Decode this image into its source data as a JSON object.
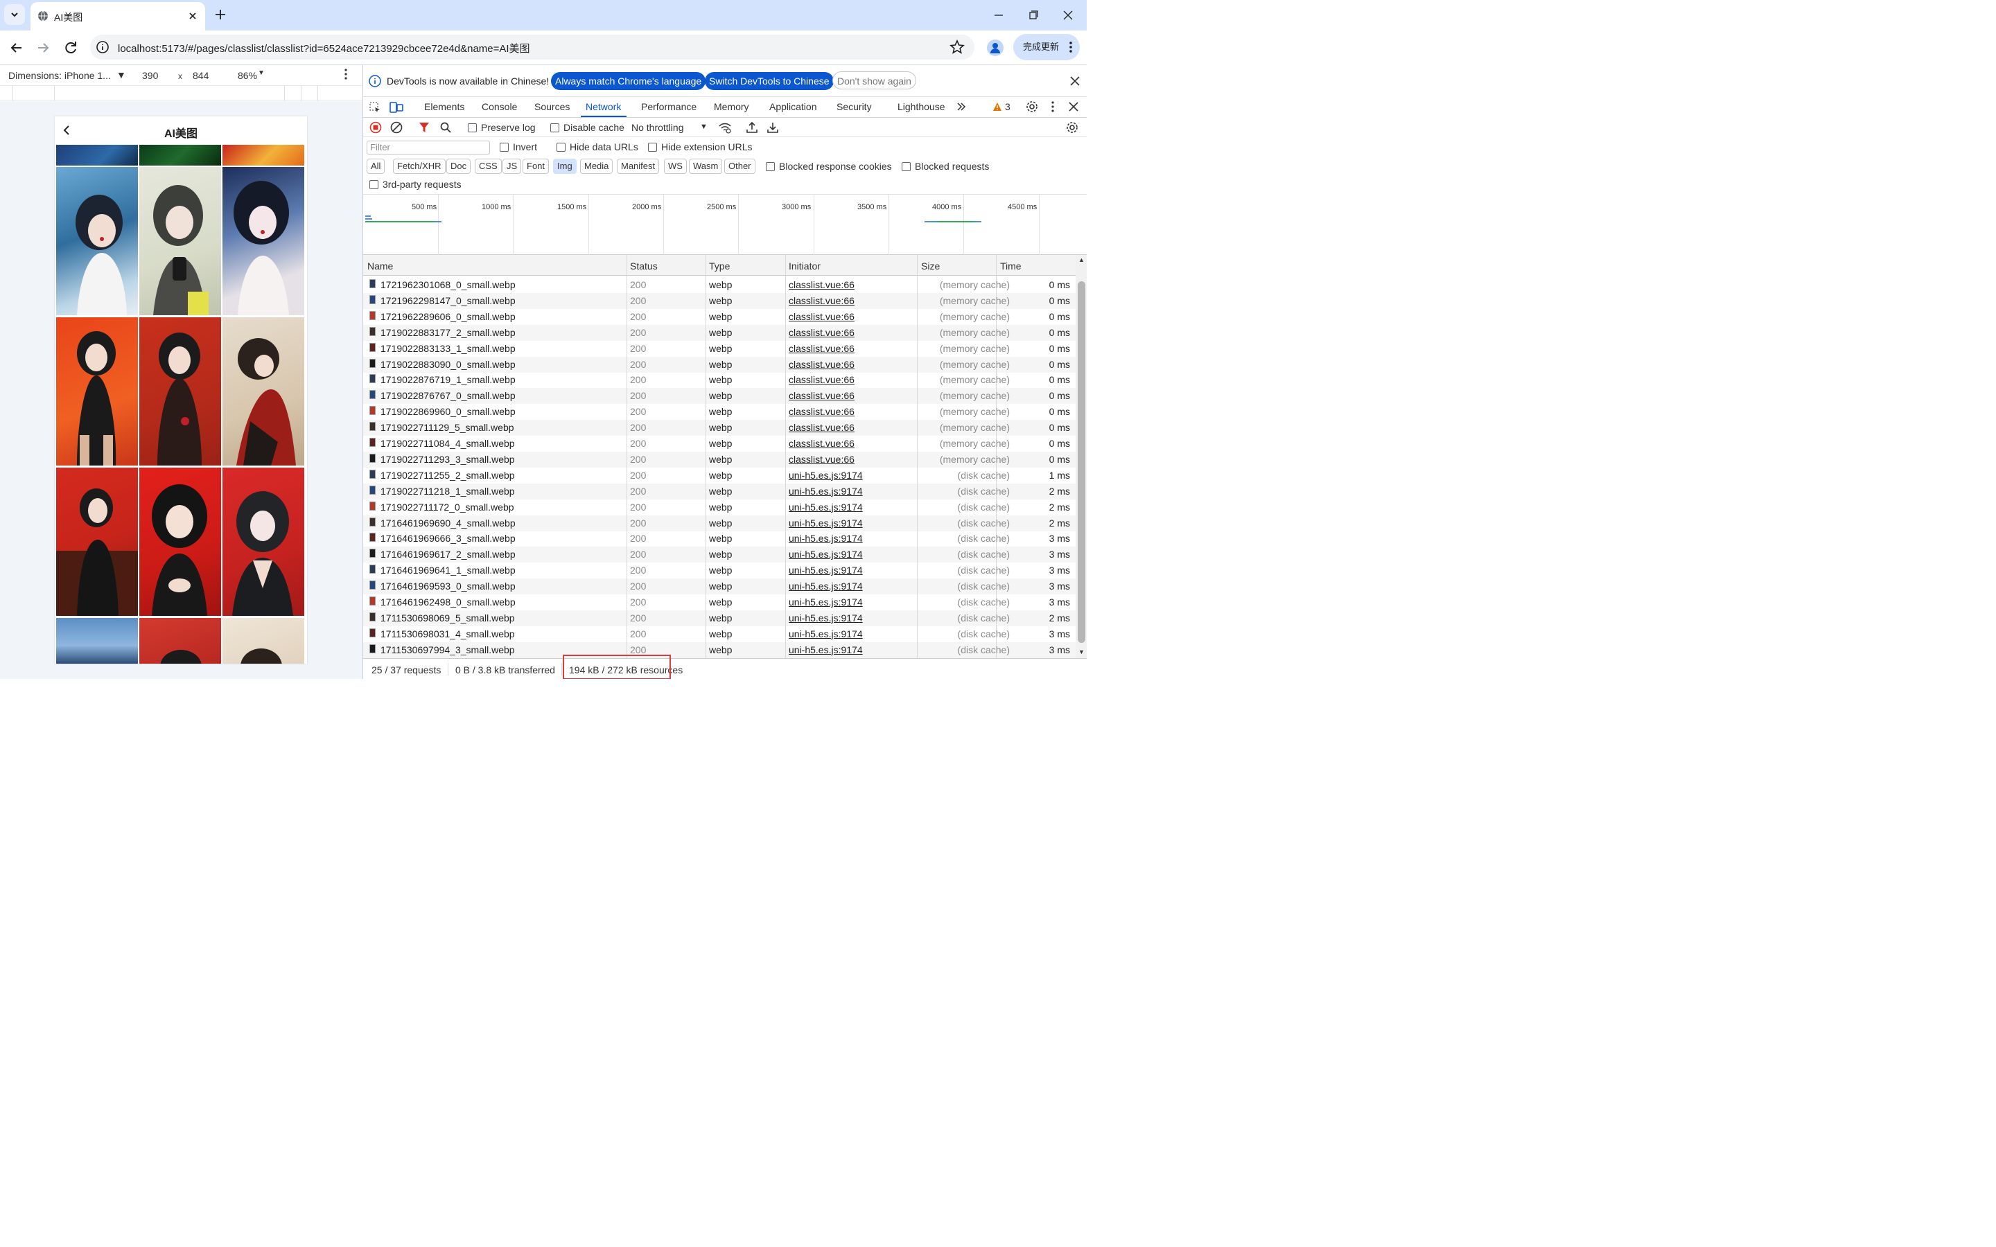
{
  "browser": {
    "tab_title": "AI美图",
    "url": "localhost:5173/#/pages/classlist/classlist?id=6524ace7213929cbcee72e4d&name=AI美图",
    "update_label": "完成更新"
  },
  "device_toolbar": {
    "dimensions": "Dimensions: iPhone 1...",
    "width": "390",
    "times": "x",
    "height": "844",
    "zoom": "86%"
  },
  "phone": {
    "title": "AI美图"
  },
  "devtools": {
    "info_text": "DevTools is now available in Chinese!",
    "btn_always": "Always match Chrome's language",
    "btn_switch": "Switch DevTools to Chinese",
    "btn_dont": "Don't show again",
    "tabs": [
      "Elements",
      "Console",
      "Sources",
      "Network",
      "Performance",
      "Memory",
      "Application",
      "Security",
      "Lighthouse"
    ],
    "warning_count": "3",
    "preserve_log": "Preserve log",
    "disable_cache": "Disable cache",
    "throttling": "No throttling",
    "filter_placeholder": "Filter",
    "invert": "Invert",
    "hide_data": "Hide data URLs",
    "hide_ext": "Hide extension URLs",
    "types": [
      "All",
      "Fetch/XHR",
      "Doc",
      "CSS",
      "JS",
      "Font",
      "Img",
      "Media",
      "Manifest",
      "WS",
      "Wasm",
      "Other"
    ],
    "blocked_cookies": "Blocked response cookies",
    "blocked_requests": "Blocked requests",
    "third_party": "3rd-party requests",
    "timeline_ticks": [
      "500 ms",
      "1000 ms",
      "1500 ms",
      "2000 ms",
      "2500 ms",
      "3000 ms",
      "3500 ms",
      "4000 ms",
      "4500 ms"
    ],
    "columns": {
      "name": "Name",
      "status": "Status",
      "type": "Type",
      "initiator": "Initiator",
      "size": "Size",
      "time": "Time"
    },
    "rows": [
      {
        "name": "1721962301068_0_small.webp",
        "status": "200",
        "type": "webp",
        "initiator": "classlist.vue:66",
        "size": "(memory cache)",
        "time": "0 ms"
      },
      {
        "name": "1721962298147_0_small.webp",
        "status": "200",
        "type": "webp",
        "initiator": "classlist.vue:66",
        "size": "(memory cache)",
        "time": "0 ms"
      },
      {
        "name": "1721962289606_0_small.webp",
        "status": "200",
        "type": "webp",
        "initiator": "classlist.vue:66",
        "size": "(memory cache)",
        "time": "0 ms"
      },
      {
        "name": "1719022883177_2_small.webp",
        "status": "200",
        "type": "webp",
        "initiator": "classlist.vue:66",
        "size": "(memory cache)",
        "time": "0 ms"
      },
      {
        "name": "1719022883133_1_small.webp",
        "status": "200",
        "type": "webp",
        "initiator": "classlist.vue:66",
        "size": "(memory cache)",
        "time": "0 ms"
      },
      {
        "name": "1719022883090_0_small.webp",
        "status": "200",
        "type": "webp",
        "initiator": "classlist.vue:66",
        "size": "(memory cache)",
        "time": "0 ms"
      },
      {
        "name": "1719022876719_1_small.webp",
        "status": "200",
        "type": "webp",
        "initiator": "classlist.vue:66",
        "size": "(memory cache)",
        "time": "0 ms"
      },
      {
        "name": "1719022876767_0_small.webp",
        "status": "200",
        "type": "webp",
        "initiator": "classlist.vue:66",
        "size": "(memory cache)",
        "time": "0 ms"
      },
      {
        "name": "1719022869960_0_small.webp",
        "status": "200",
        "type": "webp",
        "initiator": "classlist.vue:66",
        "size": "(memory cache)",
        "time": "0 ms"
      },
      {
        "name": "1719022711129_5_small.webp",
        "status": "200",
        "type": "webp",
        "initiator": "classlist.vue:66",
        "size": "(memory cache)",
        "time": "0 ms"
      },
      {
        "name": "1719022711084_4_small.webp",
        "status": "200",
        "type": "webp",
        "initiator": "classlist.vue:66",
        "size": "(memory cache)",
        "time": "0 ms"
      },
      {
        "name": "1719022711293_3_small.webp",
        "status": "200",
        "type": "webp",
        "initiator": "classlist.vue:66",
        "size": "(memory cache)",
        "time": "0 ms"
      },
      {
        "name": "1719022711255_2_small.webp",
        "status": "200",
        "type": "webp",
        "initiator": "uni-h5.es.js:9174",
        "size": "(disk cache)",
        "time": "1 ms"
      },
      {
        "name": "1719022711218_1_small.webp",
        "status": "200",
        "type": "webp",
        "initiator": "uni-h5.es.js:9174",
        "size": "(disk cache)",
        "time": "2 ms"
      },
      {
        "name": "1719022711172_0_small.webp",
        "status": "200",
        "type": "webp",
        "initiator": "uni-h5.es.js:9174",
        "size": "(disk cache)",
        "time": "2 ms"
      },
      {
        "name": "1716461969690_4_small.webp",
        "status": "200",
        "type": "webp",
        "initiator": "uni-h5.es.js:9174",
        "size": "(disk cache)",
        "time": "2 ms"
      },
      {
        "name": "1716461969666_3_small.webp",
        "status": "200",
        "type": "webp",
        "initiator": "uni-h5.es.js:9174",
        "size": "(disk cache)",
        "time": "3 ms"
      },
      {
        "name": "1716461969617_2_small.webp",
        "status": "200",
        "type": "webp",
        "initiator": "uni-h5.es.js:9174",
        "size": "(disk cache)",
        "time": "3 ms"
      },
      {
        "name": "1716461969641_1_small.webp",
        "status": "200",
        "type": "webp",
        "initiator": "uni-h5.es.js:9174",
        "size": "(disk cache)",
        "time": "3 ms"
      },
      {
        "name": "1716461969593_0_small.webp",
        "status": "200",
        "type": "webp",
        "initiator": "uni-h5.es.js:9174",
        "size": "(disk cache)",
        "time": "3 ms"
      },
      {
        "name": "1716461962498_0_small.webp",
        "status": "200",
        "type": "webp",
        "initiator": "uni-h5.es.js:9174",
        "size": "(disk cache)",
        "time": "3 ms"
      },
      {
        "name": "1711530698069_5_small.webp",
        "status": "200",
        "type": "webp",
        "initiator": "uni-h5.es.js:9174",
        "size": "(disk cache)",
        "time": "2 ms"
      },
      {
        "name": "1711530698031_4_small.webp",
        "status": "200",
        "type": "webp",
        "initiator": "uni-h5.es.js:9174",
        "size": "(disk cache)",
        "time": "3 ms"
      },
      {
        "name": "1711530697994_3_small.webp",
        "status": "200",
        "type": "webp",
        "initiator": "uni-h5.es.js:9174",
        "size": "(disk cache)",
        "time": "3 ms"
      }
    ],
    "status_requests": "25 / 37 requests",
    "status_transferred": "0 B / 3.8 kB transferred",
    "status_resources": "194 kB / 272 kB resources"
  },
  "colors": {
    "accent": "#0b57d0",
    "tabstrip": "#d3e3fd",
    "highlight": "#e03b3b",
    "record": "#d93025"
  }
}
